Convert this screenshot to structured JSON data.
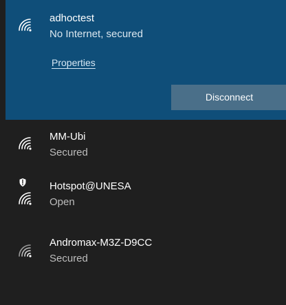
{
  "networks": [
    {
      "ssid": "adhoctest",
      "status": "No Internet, secured",
      "properties_label": "Properties",
      "action_label": "Disconnect"
    },
    {
      "ssid": "MM-Ubi",
      "status": "Secured"
    },
    {
      "ssid": "Hotspot@UNESA",
      "status": "Open"
    },
    {
      "ssid": "Andromax-M3Z-D9CC",
      "status": "Secured"
    }
  ],
  "icons": {
    "wifi": "wifi-icon",
    "shield": "shield-icon"
  },
  "colors": {
    "panel_bg": "#1f1f1f",
    "selected_bg": "#0f4e79",
    "button_bg": "#4a6f89"
  }
}
